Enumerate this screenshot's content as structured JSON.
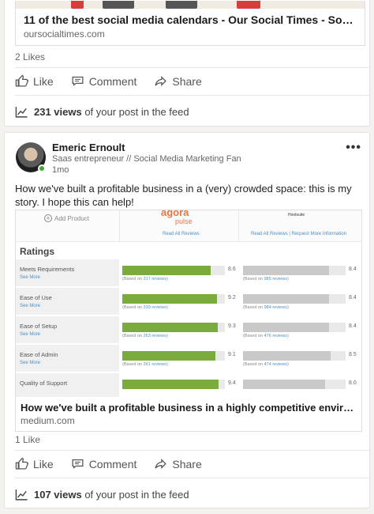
{
  "colors": {
    "accent_green": "#7cab3d",
    "gray_bar": "#c9c9c9",
    "link_blue": "#4a8fc7",
    "brand_orange": "#e07745"
  },
  "post1": {
    "link_title": "11 of the best social media calendars - Our Social Times - Social Medi…",
    "link_url": "oursocialtimes.com",
    "likes": "2 Likes",
    "actions": {
      "like": "Like",
      "comment": "Comment",
      "share": "Share"
    },
    "views_count": "231 views",
    "views_suffix": " of your post in the feed"
  },
  "post2": {
    "author": "Emeric Ernoult",
    "headline": "Saas entrepreneur // Social Media Marketing Fan",
    "time": "1mo",
    "more": "•••",
    "text": "How we've built a profitable business in a (very) crowded space: this is my story. I hope this can help!",
    "embed": {
      "add_product": "Add Product",
      "brand1": {
        "line1": "agora",
        "line2": "pulse",
        "all_reviews": "Read All Reviews"
      },
      "brand2": {
        "logo": "Hootsuite",
        "all_reviews": "Read All Reviews | Request More Information"
      },
      "ratings_title": "Ratings",
      "see_more": "See More",
      "rows": [
        {
          "label": "Meets Requirements",
          "a_score": "8.6",
          "a_value": 8.6,
          "a_based": "317 reviews",
          "b_score": "8.4",
          "b_value": 8.4,
          "b_based": "985 reviews"
        },
        {
          "label": "Ease of Use",
          "a_score": "9.2",
          "a_value": 9.2,
          "a_based": "319 reviews",
          "b_score": "8.4",
          "b_value": 8.4,
          "b_based": "984 reviews"
        },
        {
          "label": "Ease of Setup",
          "a_score": "9.3",
          "a_value": 9.3,
          "a_based": "263 reviews",
          "b_score": "8.4",
          "b_value": 8.4,
          "b_based": "476 reviews"
        },
        {
          "label": "Ease of Admin",
          "a_score": "9.1",
          "a_value": 9.1,
          "a_based": "261 reviews",
          "b_score": "8.5",
          "b_value": 8.5,
          "b_based": "474 reviews"
        },
        {
          "label": "Quality of Support",
          "a_score": "9.4",
          "a_value": 9.4,
          "a_based": "",
          "b_score": "8.0",
          "b_value": 8.0,
          "b_based": ""
        }
      ],
      "based_prefix": "(Based on ",
      "based_suffix": ")",
      "title": "How we've built a profitable business in a highly competitive environm…",
      "url": "medium.com"
    },
    "likes": "1 Like",
    "actions": {
      "like": "Like",
      "comment": "Comment",
      "share": "Share"
    },
    "views_count": "107 views",
    "views_suffix": " of your post in the feed"
  }
}
